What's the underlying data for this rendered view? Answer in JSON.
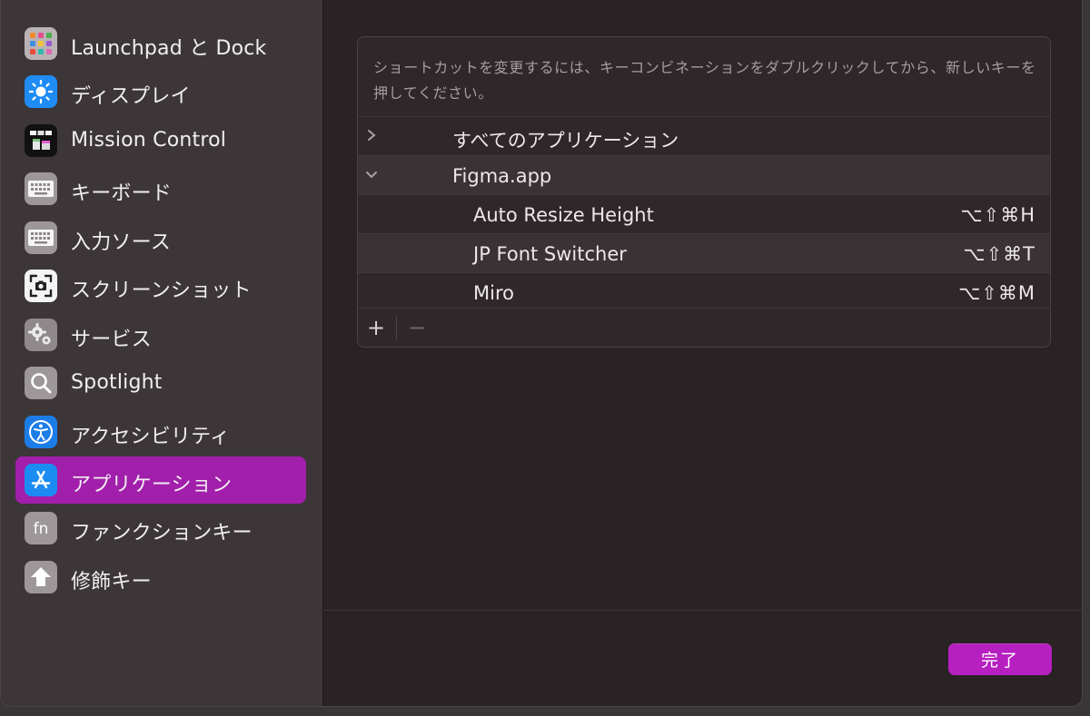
{
  "sidebar": {
    "items": [
      {
        "label": "Launchpad と Dock",
        "icon": "launchpad-icon"
      },
      {
        "label": "ディスプレイ",
        "icon": "display-brightness-icon"
      },
      {
        "label": "Mission Control",
        "icon": "mission-control-icon"
      },
      {
        "label": "キーボード",
        "icon": "keyboard-icon"
      },
      {
        "label": "入力ソース",
        "icon": "input-sources-icon"
      },
      {
        "label": "スクリーンショット",
        "icon": "screenshot-icon"
      },
      {
        "label": "サービス",
        "icon": "gears-icon"
      },
      {
        "label": "Spotlight",
        "icon": "magnifier-icon"
      },
      {
        "label": "アクセシビリティ",
        "icon": "accessibility-icon"
      },
      {
        "label": "アプリケーション",
        "icon": "app-store-icon",
        "selected": true
      },
      {
        "label": "ファンクションキー",
        "icon": "fn-key-icon"
      },
      {
        "label": "修飾キー",
        "icon": "modifier-arrow-icon"
      }
    ]
  },
  "main": {
    "hint": "ショートカットを変更するには、キーコンビネーションをダブルクリックしてから、新しいキーを押してください。",
    "groups": [
      {
        "label": "すべてのアプリケーション",
        "expanded": false
      },
      {
        "label": "Figma.app",
        "expanded": true
      }
    ],
    "shortcuts": [
      {
        "label": "Auto Resize Height",
        "keys": "⌥⇧⌘H"
      },
      {
        "label": "JP Font Switcher",
        "keys": "⌥⇧⌘T"
      },
      {
        "label": "Miro",
        "keys": "⌥⇧⌘M"
      }
    ],
    "toolbar": {
      "add": "+",
      "remove": "−"
    }
  },
  "footer": {
    "done_label": "完了"
  },
  "colors": {
    "accent": "#b61fc0",
    "selected": "#a11fab"
  }
}
